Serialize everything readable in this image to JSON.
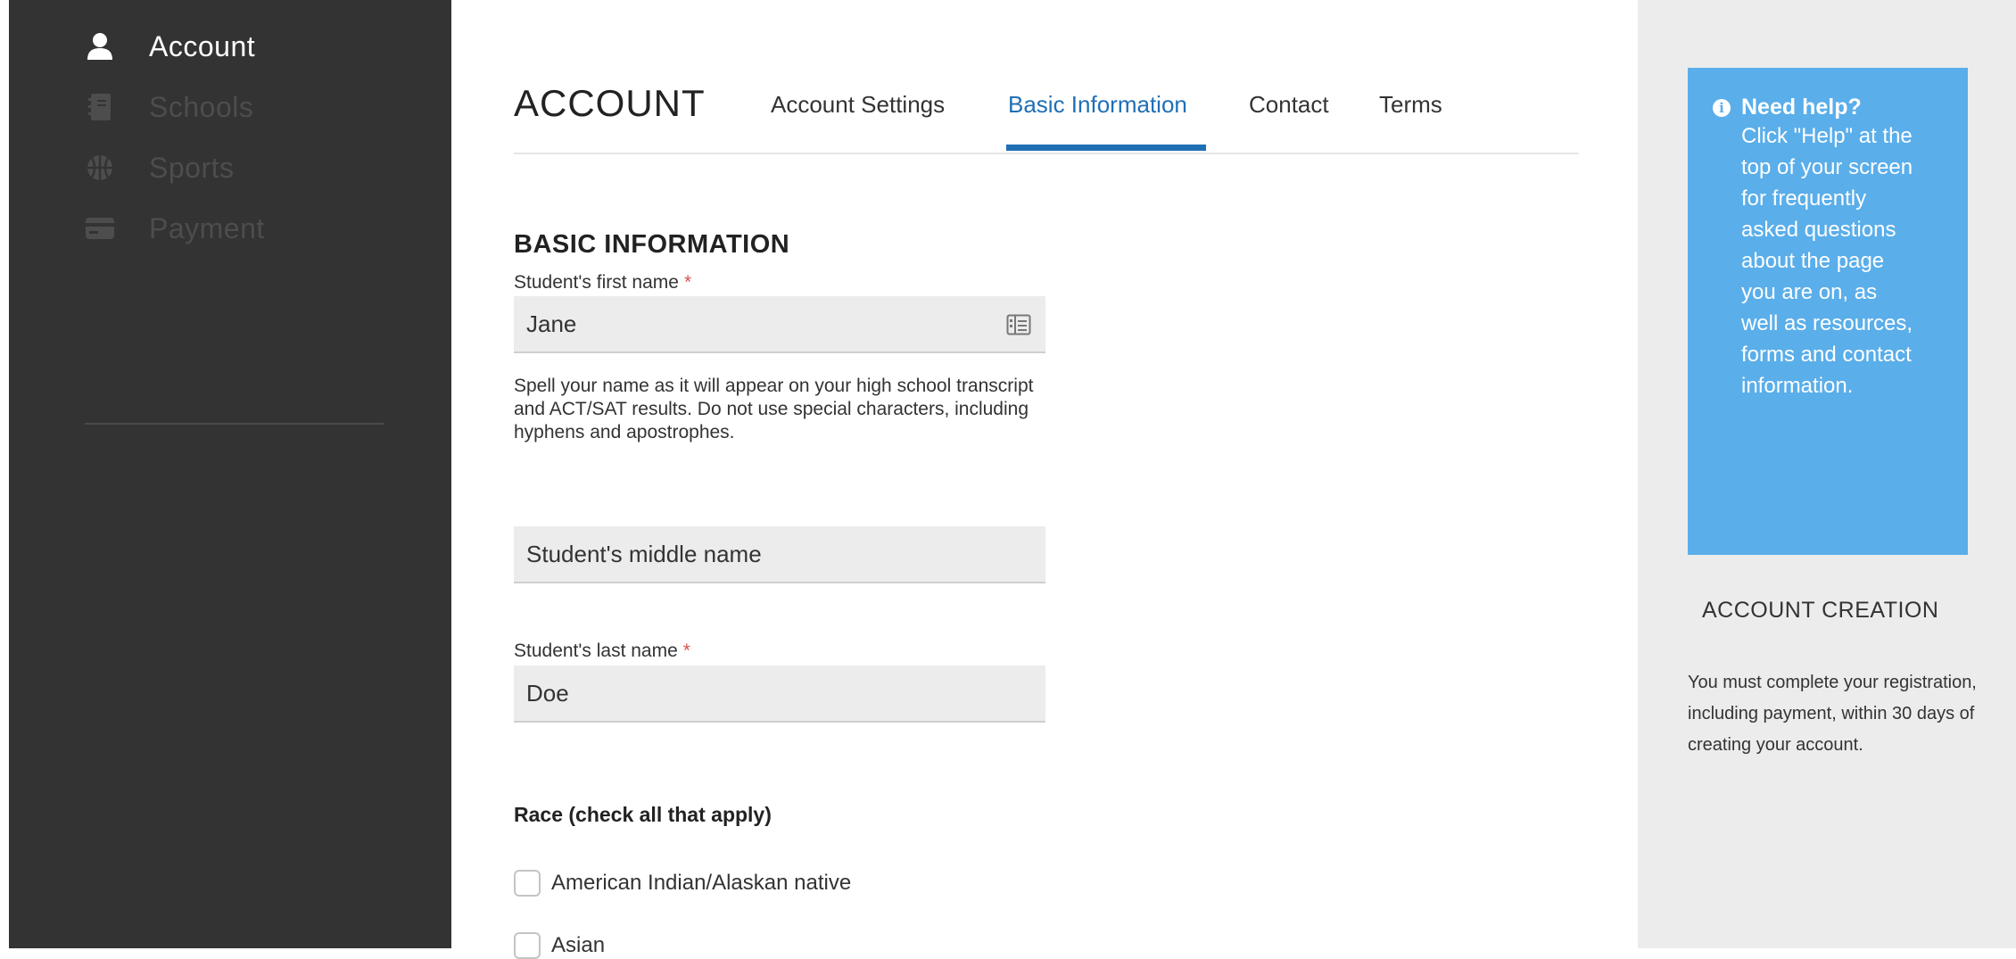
{
  "sidebar": {
    "items": [
      {
        "label": "Account",
        "icon": "user-icon",
        "active": true
      },
      {
        "label": "Schools",
        "icon": "notebook-icon",
        "active": false
      },
      {
        "label": "Sports",
        "icon": "basketball-icon",
        "active": false
      },
      {
        "label": "Payment",
        "icon": "credit-card-icon",
        "active": false
      }
    ]
  },
  "header": {
    "title": "ACCOUNT",
    "tabs": [
      {
        "label": "Account Settings",
        "active": false
      },
      {
        "label": "Basic Information",
        "active": true
      },
      {
        "label": "Contact",
        "active": false
      },
      {
        "label": "Terms",
        "active": false
      }
    ]
  },
  "form": {
    "section_title": "BASIC INFORMATION",
    "first_name": {
      "label": "Student's first name",
      "required_mark": "*",
      "value": "Jane",
      "icon": "contact-card-icon",
      "help": "Spell your name as it will appear on your high school transcript and ACT/SAT results. Do not use special characters, including hyphens and apostrophes."
    },
    "middle_name": {
      "placeholder": "Student's middle name",
      "value": ""
    },
    "last_name": {
      "label": "Student's last name",
      "required_mark": "*",
      "value": "Doe"
    },
    "race": {
      "heading": "Race (check all that apply)",
      "options": [
        {
          "label": "American Indian/Alaskan native",
          "checked": false
        },
        {
          "label": "Asian",
          "checked": false
        }
      ]
    }
  },
  "help_panel": {
    "title": "Need help?",
    "body": "Click \"Help\" at the top of your screen for frequently asked questions about the page you are on, as well as resources, forms and contact information.",
    "icon": "info-icon"
  },
  "account_creation": {
    "heading": "ACCOUNT CREATION",
    "text": "You must complete your registration, including payment, within 30 days of creating your account."
  },
  "colors": {
    "sidebar_bg": "#333333",
    "accent_blue": "#1f6fb5",
    "help_box_bg": "#5aaeea",
    "right_panel_bg": "#ececec",
    "required_red": "#d9534f"
  }
}
